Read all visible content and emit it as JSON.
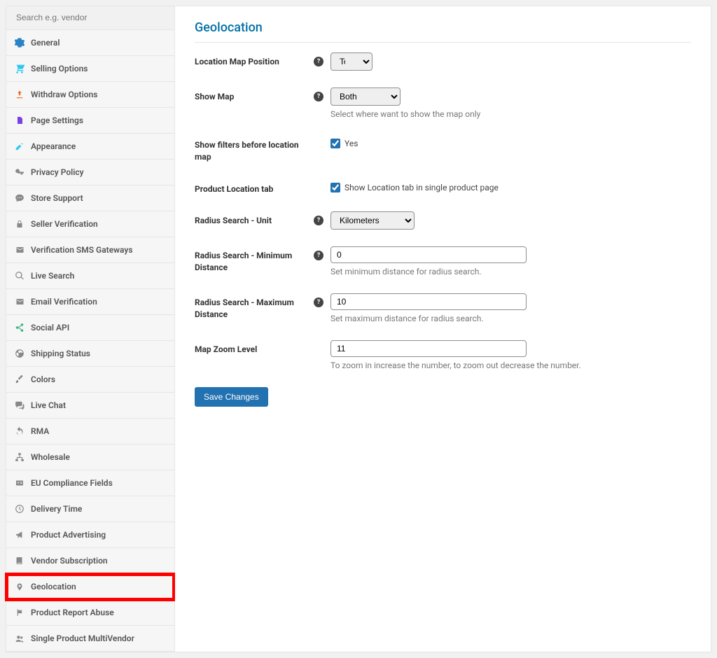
{
  "search": {
    "placeholder": "Search e.g. vendor"
  },
  "sidebar": {
    "items": [
      {
        "label": "General"
      },
      {
        "label": "Selling Options"
      },
      {
        "label": "Withdraw Options"
      },
      {
        "label": "Page Settings"
      },
      {
        "label": "Appearance"
      },
      {
        "label": "Privacy Policy"
      },
      {
        "label": "Store Support"
      },
      {
        "label": "Seller Verification"
      },
      {
        "label": "Verification SMS Gateways"
      },
      {
        "label": "Live Search"
      },
      {
        "label": "Email Verification"
      },
      {
        "label": "Social API"
      },
      {
        "label": "Shipping Status"
      },
      {
        "label": "Colors"
      },
      {
        "label": "Live Chat"
      },
      {
        "label": "RMA"
      },
      {
        "label": "Wholesale"
      },
      {
        "label": "EU Compliance Fields"
      },
      {
        "label": "Delivery Time"
      },
      {
        "label": "Product Advertising"
      },
      {
        "label": "Vendor Subscription"
      },
      {
        "label": "Geolocation"
      },
      {
        "label": "Product Report Abuse"
      },
      {
        "label": "Single Product MultiVendor"
      }
    ]
  },
  "page": {
    "title": "Geolocation",
    "fields": {
      "map_position": {
        "label": "Location Map Position",
        "value": "Top"
      },
      "show_map": {
        "label": "Show Map",
        "value": "Both",
        "hint": "Select where want to show the map only"
      },
      "show_filters": {
        "label": "Show filters before location map",
        "checkbox_label": "Yes",
        "checked": true
      },
      "product_tab": {
        "label": "Product Location tab",
        "checkbox_label": "Show Location tab in single product page",
        "checked": true
      },
      "radius_unit": {
        "label": "Radius Search - Unit",
        "value": "Kilometers"
      },
      "radius_min": {
        "label": "Radius Search - Minimum Distance",
        "value": "0",
        "hint": "Set minimum distance for radius search."
      },
      "radius_max": {
        "label": "Radius Search - Maximum Distance",
        "value": "10",
        "hint": "Set maximum distance for radius search."
      },
      "map_zoom": {
        "label": "Map Zoom Level",
        "value": "11",
        "hint": "To zoom in increase the number, to zoom out decrease the number."
      }
    },
    "save_label": "Save Changes"
  }
}
